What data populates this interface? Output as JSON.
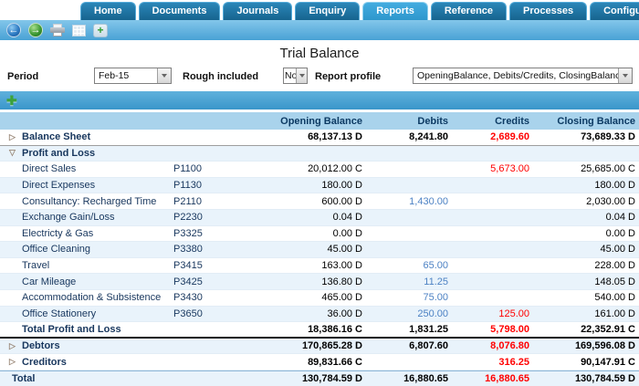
{
  "tabs": [
    {
      "label": "Home",
      "active": false
    },
    {
      "label": "Documents",
      "active": false
    },
    {
      "label": "Journals",
      "active": false
    },
    {
      "label": "Enquiry",
      "active": false
    },
    {
      "label": "Reports",
      "active": true
    },
    {
      "label": "Reference",
      "active": false
    },
    {
      "label": "Processes",
      "active": false
    },
    {
      "label": "Configuration",
      "active": false
    }
  ],
  "toolbar": {
    "icons": [
      "back",
      "forward",
      "print",
      "grid",
      "add"
    ]
  },
  "title": "Trial Balance",
  "filters": {
    "period": {
      "label": "Period",
      "value": "Feb-15"
    },
    "rough": {
      "label": "Rough included",
      "value": "No"
    },
    "profile": {
      "label": "Report profile",
      "value": "OpeningBalance, Debits/Credits, ClosingBalance"
    }
  },
  "table": {
    "columns": [
      "Opening Balance",
      "Debits",
      "Credits",
      "Closing Balance"
    ],
    "rows": [
      {
        "kind": "group",
        "expanded": false,
        "name": "Balance Sheet",
        "code": "",
        "opening": "68,137.13 D",
        "debits": "8,241.80",
        "credits": "2,689.60",
        "closing": "73,689.33 D",
        "rule_after": true
      },
      {
        "kind": "group",
        "expanded": true,
        "name": "Profit and Loss",
        "code": "",
        "opening": "",
        "debits": "",
        "credits": "",
        "closing": ""
      },
      {
        "kind": "account",
        "name": "Direct Sales",
        "code": "P1100",
        "opening": "20,012.00 C",
        "debits": "",
        "credits": "5,673.00",
        "closing": "25,685.00 C"
      },
      {
        "kind": "account",
        "name": "Direct Expenses",
        "code": "P1130",
        "opening": "180.00 D",
        "debits": "",
        "credits": "",
        "closing": "180.00 D"
      },
      {
        "kind": "account",
        "name": "Consultancy: Recharged Time",
        "code": "P2110",
        "opening": "600.00 D",
        "debits": "1,430.00",
        "credits": "",
        "closing": "2,030.00 D"
      },
      {
        "kind": "account",
        "name": "Exchange Gain/Loss",
        "code": "P2230",
        "opening": "0.04 D",
        "debits": "",
        "credits": "",
        "closing": "0.04 D"
      },
      {
        "kind": "account",
        "name": "Electricty & Gas",
        "code": "P3325",
        "opening": "0.00 D",
        "debits": "",
        "credits": "",
        "closing": "0.00 D"
      },
      {
        "kind": "account",
        "name": "Office Cleaning",
        "code": "P3380",
        "opening": "45.00 D",
        "debits": "",
        "credits": "",
        "closing": "45.00 D"
      },
      {
        "kind": "account",
        "name": "Travel",
        "code": "P3415",
        "opening": "163.00 D",
        "debits": "65.00",
        "credits": "",
        "closing": "228.00 D"
      },
      {
        "kind": "account",
        "name": "Car Mileage",
        "code": "P3425",
        "opening": "136.80 D",
        "debits": "11.25",
        "credits": "",
        "closing": "148.05 D"
      },
      {
        "kind": "account",
        "name": "Accommodation & Subsistence",
        "code": "P3430",
        "opening": "465.00 D",
        "debits": "75.00",
        "credits": "",
        "closing": "540.00 D"
      },
      {
        "kind": "account",
        "name": "Office Stationery",
        "code": "P3650",
        "opening": "36.00 D",
        "debits": "250.00",
        "credits": "125.00",
        "closing": "161.00 D"
      },
      {
        "kind": "total",
        "name": "Total Profit and Loss",
        "code": "",
        "opening": "18,386.16 C",
        "debits": "1,831.25",
        "credits": "5,798.00",
        "closing": "22,352.91 C",
        "separator_after": true
      },
      {
        "kind": "group",
        "expanded": false,
        "name": "Debtors",
        "code": "",
        "opening": "170,865.28 D",
        "debits": "6,807.60",
        "credits": "8,076.80",
        "closing": "169,596.08 D"
      },
      {
        "kind": "group",
        "expanded": false,
        "name": "Creditors",
        "code": "",
        "opening": "89,831.66 C",
        "debits": "",
        "credits": "316.25",
        "closing": "90,147.91 C"
      },
      {
        "kind": "grand",
        "name": "Total",
        "code": "",
        "opening": "130,784.59 D",
        "debits": "16,880.65",
        "credits": "16,880.65",
        "closing": "130,784.59 D",
        "rule_before": true
      }
    ]
  },
  "colors": {
    "tab_active": "#2E97CC",
    "tab_inactive": "#16648F",
    "toolbar": "#49A2D5",
    "header_bg": "#A9D3EC",
    "header_text": "#0C3A63",
    "stripe": "#E9F3FB",
    "name_text": "#17365D",
    "debit_link": "#4D82C4",
    "credit_red": "#FF0000"
  }
}
